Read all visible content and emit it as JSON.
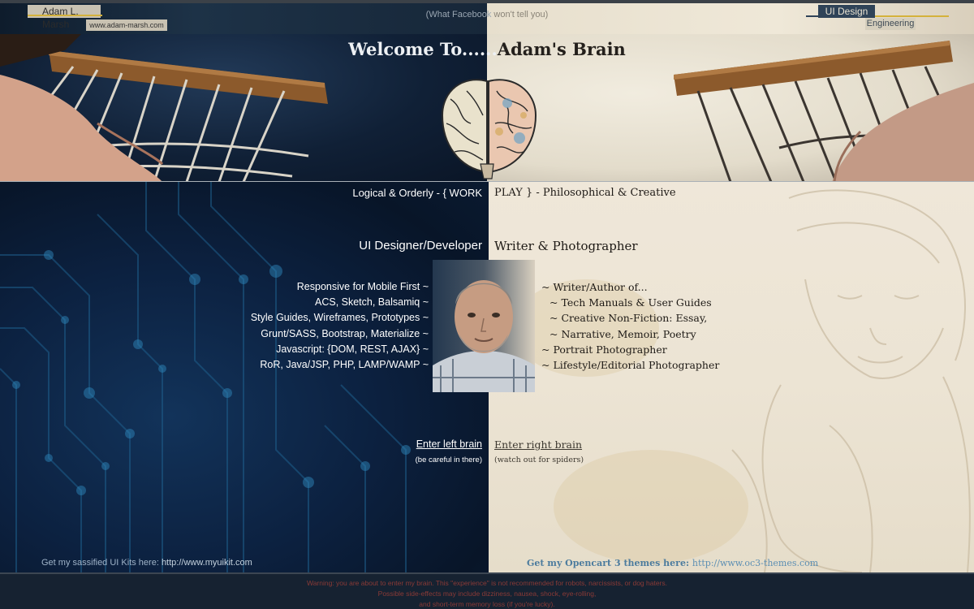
{
  "header": {
    "logo_name": "Adam L. Marsh",
    "logo_url": "www.adam-marsh.com",
    "tagline_left": "(What Facebook",
    "tagline_right": " won't tell you)",
    "badge_ui": "UI Design",
    "badge_engineering": "Engineering",
    "welcome_left": "Welcome To......",
    "welcome_right": "Adam's Brain"
  },
  "left": {
    "motto": "Logical & Orderly - { WORK",
    "role": "UI Designer/Developer",
    "skills": [
      "Responsive for Mobile First ~",
      "ACS, Sketch, Balsamiq ~",
      "Style Guides, Wireframes, Prototypes ~",
      "Grunt/SASS, Bootstrap, Materialize ~",
      "Javascript: {DOM, REST, AJAX} ~",
      "RoR, Java/JSP, PHP, LAMP/WAMP ~"
    ],
    "enter_link": "Enter left brain",
    "enter_note": "(be careful in there)",
    "kit_prefix": "Get my sassified UI Kits here: ",
    "kit_link": "http://www.myuikit.com"
  },
  "right": {
    "motto": "PLAY } - Philosophical & Creative",
    "role": "Writer & Photographer",
    "skills": [
      "~ Writer/Author of...",
      "~ Tech Manuals & User Guides",
      "~ Creative Non-Fiction: Essay,",
      "~ Narrative, Memoir, Poetry",
      "~ Portrait Photographer",
      "~ Lifestyle/Editorial Photographer"
    ],
    "enter_link": "Enter right brain",
    "enter_note": "(watch out for spiders)",
    "kit_prefix": "Get my Opencart 3 themes here: ",
    "kit_link": "http://www.oc3-themes.com"
  },
  "footer": {
    "line1": "Warning: you are about to enter my brain. This \"experience\" is not recommended for robots, narcissists, or dog haters.",
    "line2": "Possible side-effects may include dizziness, nausea, shock, eye-rolling,",
    "line3": "and short-term memory loss (if you're lucky)."
  },
  "colors": {
    "left_bg": "#0c2140",
    "right_bg": "#ece4d4",
    "accent_gold": "#d4b23c",
    "footer_warning": "#8a3a36"
  }
}
